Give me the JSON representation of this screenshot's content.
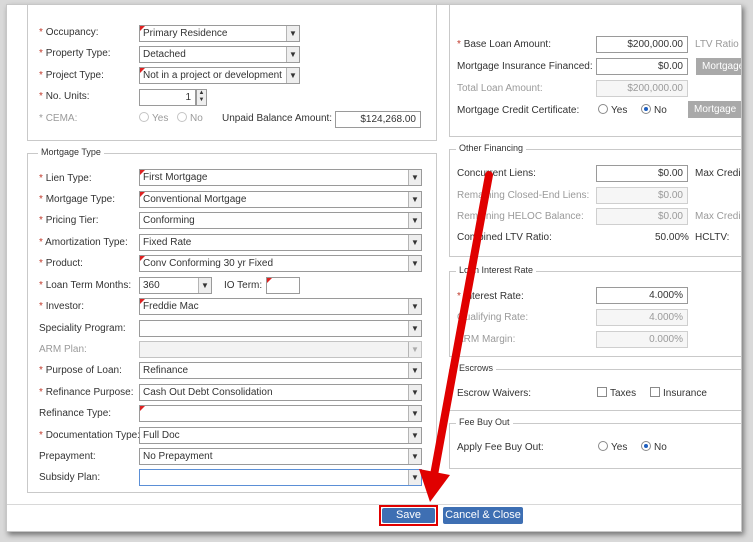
{
  "property": {
    "occupancy_label": "Occupancy:",
    "occupancy_value": "Primary Residence",
    "property_type_label": "Property Type:",
    "property_type_value": "Detached",
    "project_type_label": "Project Type:",
    "project_type_value": "Not in a project or development",
    "no_units_label": "No. Units:",
    "no_units_value": "1",
    "cema_label": "CEMA:",
    "cema_yes": "Yes",
    "cema_no": "No",
    "unpaid_balance_label": "Unpaid Balance Amount:",
    "unpaid_balance_value": "$124,268.00"
  },
  "loan_amount": {
    "base_loan_label": "Base Loan Amount:",
    "base_loan_value": "$200,000.00",
    "ltv_ratio_label": "LTV Ratio",
    "mi_financed_label": "Mortgage Insurance Financed:",
    "mi_financed_value": "$0.00",
    "mortgage_btn_1": "Mortgage",
    "total_loan_label": "Total Loan Amount:",
    "total_loan_value": "$200,000.00",
    "mcc_label": "Mortgage Credit Certificate:",
    "mcc_yes": "Yes",
    "mcc_no": "No",
    "mortgage_btn_2": "Mortgage"
  },
  "mortgage_type": {
    "legend": "Mortgage Type",
    "lien_type_label": "Lien Type:",
    "lien_type_value": "First Mortgage",
    "mortgage_type_label": "Mortgage Type:",
    "mortgage_type_value": "Conventional Mortgage",
    "pricing_tier_label": "Pricing Tier:",
    "pricing_tier_value": "Conforming",
    "amortization_label": "Amortization Type:",
    "amortization_value": "Fixed Rate",
    "product_label": "Product:",
    "product_value": "Conv Conforming 30 yr Fixed",
    "loan_term_label": "Loan Term Months:",
    "loan_term_value": "360",
    "io_term_label": "IO Term:",
    "io_term_value": "",
    "investor_label": "Investor:",
    "investor_value": "Freddie Mac",
    "speciality_label": "Speciality Program:",
    "speciality_value": "",
    "arm_plan_label": "ARM Plan:",
    "arm_plan_value": "",
    "purpose_label": "Purpose of Loan:",
    "purpose_value": "Refinance",
    "refi_purpose_label": "Refinance Purpose:",
    "refi_purpose_value": "Cash Out Debt Consolidation",
    "refi_type_label": "Refinance Type:",
    "refi_type_value": "",
    "documentation_label": "Documentation Type:",
    "documentation_value": "Full Doc",
    "prepayment_label": "Prepayment:",
    "prepayment_value": "No Prepayment",
    "subsidy_label": "Subsidy Plan:",
    "subsidy_value": ""
  },
  "other_financing": {
    "legend": "Other Financing",
    "concurrent_label": "Concurrent Liens:",
    "concurrent_value": "$0.00",
    "max_credit_label_1": "Max Credi",
    "remaining_closed_label": "Remaining Closed-End Liens:",
    "remaining_closed_value": "$0.00",
    "remaining_heloc_label": "Remaining HELOC Balance:",
    "remaining_heloc_value": "$0.00",
    "max_credit_label_2": "Max Credi",
    "combined_ltv_label": "Combined LTV Ratio:",
    "combined_ltv_value": "50.00%",
    "hcltv_label": "HCLTV:"
  },
  "interest_rate": {
    "legend": "Loan Interest Rate",
    "interest_label": "Interest Rate:",
    "interest_value": "4.000%",
    "qualifying_label": "Qualifying Rate:",
    "qualifying_value": "4.000%",
    "arm_margin_label": "ARM Margin:",
    "arm_margin_value": "0.000%"
  },
  "escrows": {
    "legend": "Escrows",
    "waivers_label": "Escrow Waivers:",
    "taxes_label": "Taxes",
    "insurance_label": "Insurance"
  },
  "fee_buy_out": {
    "legend": "Fee Buy Out",
    "apply_label": "Apply Fee Buy Out:",
    "yes": "Yes",
    "no": "No"
  },
  "footer": {
    "save_label": "Save",
    "cancel_close_label": "Cancel & Close"
  },
  "colors": {
    "required": "#c0392b",
    "button": "#3e6fb3",
    "annotation": "#e00000"
  }
}
